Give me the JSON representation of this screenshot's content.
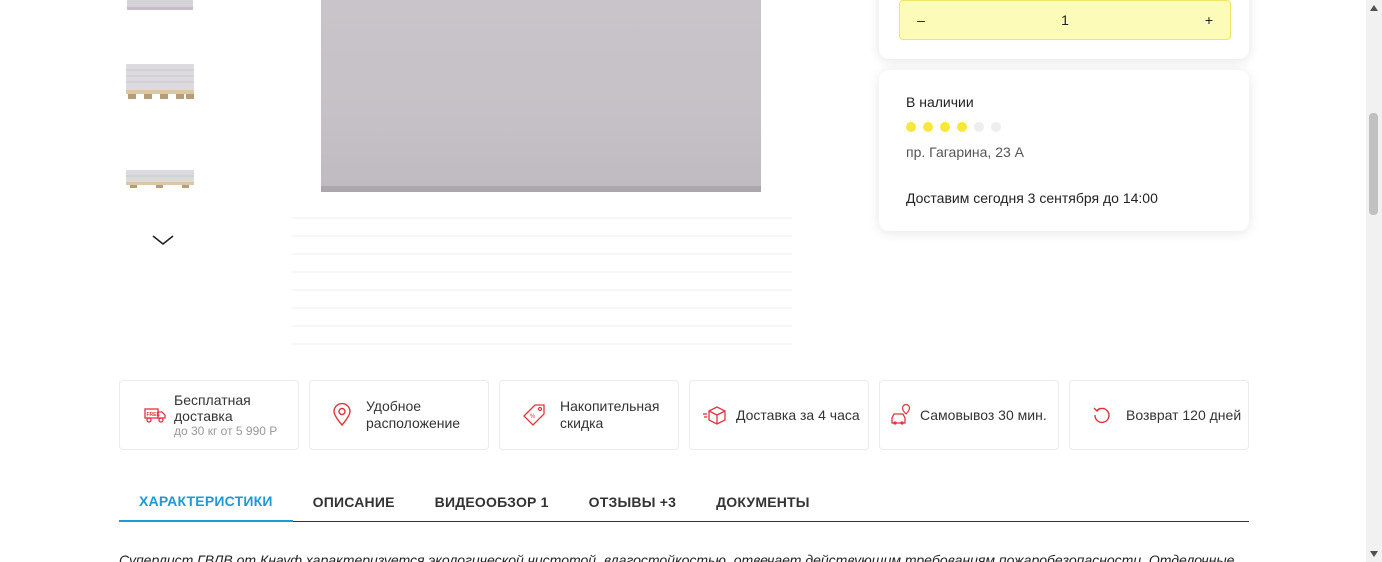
{
  "gallery": {
    "thumbnails": [
      {
        "icon": "drywall-sheet-thumbnail"
      },
      {
        "icon": "drywall-pallet-thumbnail"
      },
      {
        "icon": "drywall-stack-thumbnail"
      }
    ],
    "next_icon": "chevron-down-icon"
  },
  "quantity": {
    "minus_label": "–",
    "value": "1",
    "plus_label": "+"
  },
  "stock": {
    "status": "В наличии",
    "rating_filled": 4,
    "rating_total": 6,
    "address": "пр. Гагарина, 23 А",
    "delivery": "Доставим сегодня 3 сентября до 14:00"
  },
  "features": [
    {
      "title": "Бесплатная доставка",
      "sub": "до 30 кг от 5 990 Р",
      "icon": "free-delivery-truck-icon"
    },
    {
      "title": "Удобное расположение",
      "sub": "",
      "icon": "location-pin-icon"
    },
    {
      "title": "Накопительная скидка",
      "sub": "",
      "icon": "discount-tag-icon"
    },
    {
      "title": "Доставка за 4 часа",
      "sub": "",
      "icon": "fast-delivery-box-icon"
    },
    {
      "title": "Самовывоз 30 мин.",
      "sub": "",
      "icon": "pickup-car-icon"
    },
    {
      "title": "Возврат 120 дней",
      "sub": "",
      "icon": "return-arrow-icon"
    }
  ],
  "tabs": [
    {
      "label": "ХАРАКТЕРИСТИКИ",
      "active": true
    },
    {
      "label": "ОПИСАНИЕ",
      "active": false
    },
    {
      "label": "ВИДЕООБЗОР 1",
      "active": false
    },
    {
      "label": "ОТЗЫВЫ +3",
      "active": false
    },
    {
      "label": "ДОКУМЕНТЫ",
      "active": false
    }
  ],
  "description": "Суперлист ГВЛВ от Кнауф характеризуется экологической чистотой, влагостойкостью, отвечает действующим требованиям пожаробезопасности. Отделочные",
  "colors": {
    "accent": "#1b9ad6",
    "icon_red": "#e0343c",
    "qty_bg": "#fdfbb8",
    "rating_on": "#f6e83a"
  }
}
